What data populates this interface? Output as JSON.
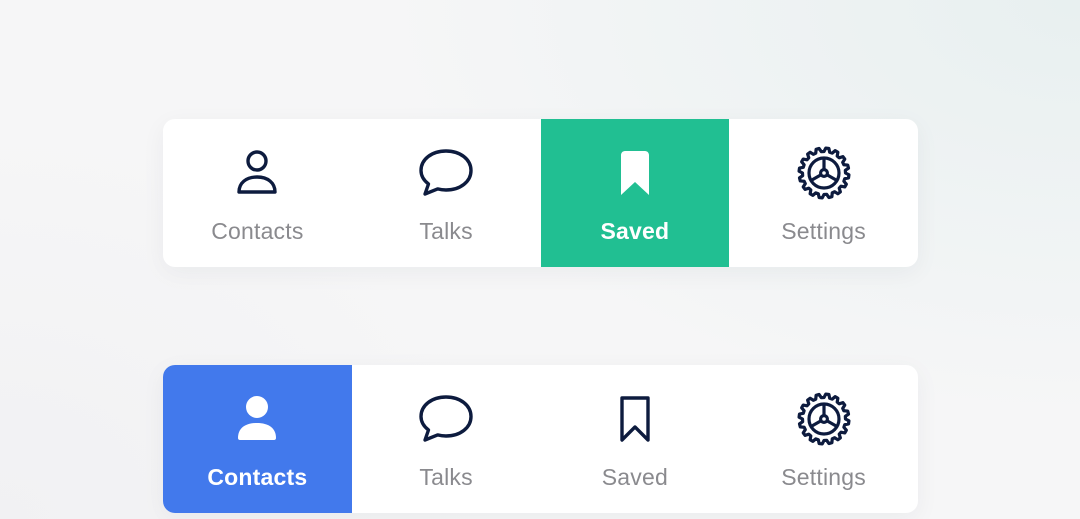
{
  "navbars": [
    {
      "accent": "#21bf92",
      "active_item": "Saved",
      "items": [
        {
          "label": "Contacts",
          "icon": "user-icon"
        },
        {
          "label": "Talks",
          "icon": "chat-bubble-icon"
        },
        {
          "label": "Saved",
          "icon": "bookmark-icon"
        },
        {
          "label": "Settings",
          "icon": "gear-icon"
        }
      ]
    },
    {
      "accent": "#4279ec",
      "active_item": "Contacts",
      "items": [
        {
          "label": "Contacts",
          "icon": "user-icon"
        },
        {
          "label": "Talks",
          "icon": "chat-bubble-icon"
        },
        {
          "label": "Saved",
          "icon": "bookmark-icon"
        },
        {
          "label": "Settings",
          "icon": "gear-icon"
        }
      ]
    }
  ],
  "colors": {
    "icon_dark": "#0d1b3e",
    "label_inactive": "#8a8a8e",
    "label_active": "#ffffff"
  }
}
